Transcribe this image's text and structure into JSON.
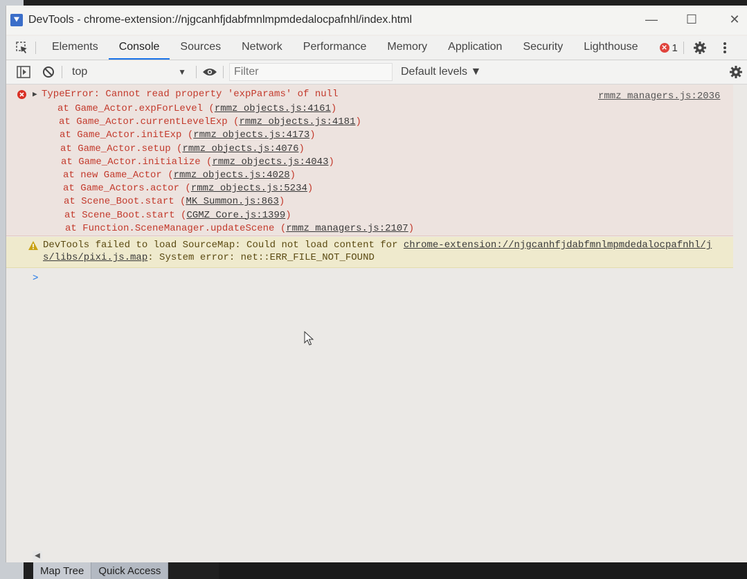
{
  "window": {
    "title": "DevTools - chrome-extension://njgcanhfjdabfmnlmpmdedalocpafnhl/index.html",
    "controls": {
      "minimize": "—",
      "maximize": "☐",
      "close": "✕"
    }
  },
  "tabs": [
    "Elements",
    "Console",
    "Sources",
    "Network",
    "Performance",
    "Memory",
    "Application",
    "Security",
    "Lighthouse"
  ],
  "active_tab": "Console",
  "error_count": "1",
  "toolbar": {
    "context": "top",
    "filter_placeholder": "Filter",
    "levels": "Default levels ▼"
  },
  "error": {
    "message": "TypeError: Cannot read property 'expParams' of null",
    "source": "rmmz_managers.js:2036",
    "stack": [
      {
        "prefix": "at Game_Actor.expForLevel (",
        "link": "rmmz_objects.js:4161",
        "suffix": ")"
      },
      {
        "prefix": "at Game_Actor.currentLevelExp (",
        "link": "rmmz_objects.js:4181",
        "suffix": ")"
      },
      {
        "prefix": "at Game_Actor.initExp (",
        "link": "rmmz_objects.js:4173",
        "suffix": ")"
      },
      {
        "prefix": "at Game_Actor.setup (",
        "link": "rmmz_objects.js:4076",
        "suffix": ")"
      },
      {
        "prefix": "at Game_Actor.initialize (",
        "link": "rmmz_objects.js:4043",
        "suffix": ")"
      },
      {
        "prefix": "at new Game_Actor (",
        "link": "rmmz_objects.js:4028",
        "suffix": ")"
      },
      {
        "prefix": "at Game_Actors.actor (",
        "link": "rmmz_objects.js:5234",
        "suffix": ")"
      },
      {
        "prefix": "at Scene_Boot.start (",
        "link": "MK_Summon.js:863",
        "suffix": ")"
      },
      {
        "prefix": "at Scene_Boot.start (",
        "link": "CGMZ_Core.js:1399",
        "suffix": ")"
      },
      {
        "prefix": "at Function.SceneManager.updateScene (",
        "link": "rmmz_managers.js:2107",
        "suffix": ")"
      }
    ]
  },
  "warning": {
    "prefix": "DevTools failed to load SourceMap: Could not load content for ",
    "link_part1": "chrome-extension://njgcanhfjdabfmnlmpmdedalocpafnhl/j",
    "link_part2": "s/libs/pixi.js.map",
    "suffix": ": System error: net::ERR_FILE_NOT_FOUND"
  },
  "prompt": ">",
  "bottom_tabs": [
    "Map Tree",
    "Quick Access"
  ],
  "icons": [
    "devtools-app-icon",
    "inspect-element-icon",
    "error-badge-icon",
    "settings-gear-icon",
    "more-vert-icon",
    "sidebar-toggle-icon",
    "clear-console-icon",
    "eye-icon",
    "warning-icon",
    "mouse-cursor-icon"
  ]
}
